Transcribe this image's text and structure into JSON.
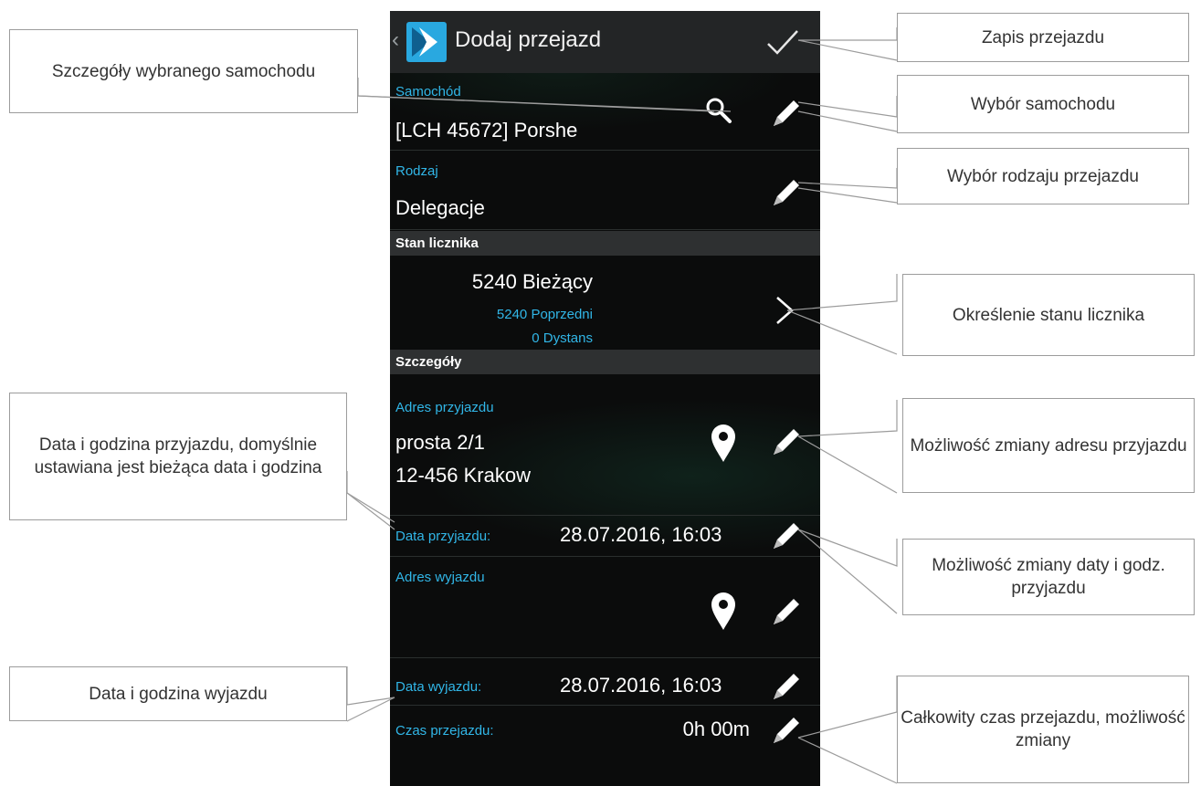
{
  "app": {
    "title": "Dodaj przejazd"
  },
  "vehicle": {
    "label": "Samochód",
    "value": "[LCH 45672] Porshe"
  },
  "trip_type": {
    "label": "Rodzaj",
    "value": "Delegacje"
  },
  "odometer": {
    "section_title": "Stan licznika",
    "current": "5240 Bieżący",
    "previous": "5240 Poprzedni",
    "distance": "0 Dystans"
  },
  "details": {
    "section_title": "Szczegóły",
    "arrival_address_label": "Adres przyjazdu",
    "arrival_address_line1": "prosta 2/1",
    "arrival_address_line2": "12-456 Krakow",
    "arrival_date_label": "Data przyjazdu:",
    "arrival_date_value": "28.07.2016, 16:03",
    "departure_address_label": "Adres wyjazdu",
    "departure_date_label": "Data wyjazdu:",
    "departure_date_value": "28.07.2016, 16:03",
    "duration_label": "Czas przejazdu:",
    "duration_value": "0h 00m"
  },
  "callouts": {
    "vehicle_details": "Szczegóły wybranego samochodu",
    "save_trip": "Zapis przejazdu",
    "choose_vehicle": "Wybór samochodu",
    "choose_trip_type": "Wybór rodzaju przejazdu",
    "odometer_state": "Określenie stanu licznika",
    "arrival_datetime": "Data i godzina przyjazdu, domyślnie ustawiana jest bieżąca data i godzina",
    "change_arrival_address": "Możliwość zmiany adresu przyjazdu",
    "change_arrival_datetime": "Możliwość zmiany daty i godz. przyjazdu",
    "departure_datetime": "Data i godzina wyjazdu",
    "total_time": "Całkowity czas przejazdu, możliwość zmiany"
  },
  "colors": {
    "accent": "#31b6e7",
    "actionbar": "#232526",
    "section_header": "#2e3031",
    "background": "#0b0c0c"
  },
  "icons": [
    "back-caret-icon",
    "app-logo-icon",
    "checkmark-icon",
    "search-icon",
    "pencil-icon",
    "chevron-right-icon",
    "map-pin-icon"
  ]
}
